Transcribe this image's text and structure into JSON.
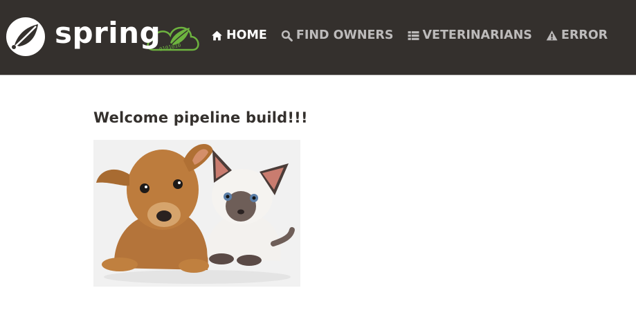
{
  "brand": {
    "wordmark": "spring",
    "cloud_digits": "0101010"
  },
  "nav": {
    "items": [
      {
        "label": "HOME",
        "icon": "home-icon",
        "active": true
      },
      {
        "label": "FIND OWNERS",
        "icon": "search-icon",
        "active": false
      },
      {
        "label": "VETERINARIANS",
        "icon": "list-icon",
        "active": false
      },
      {
        "label": "ERROR",
        "icon": "warning-icon",
        "active": false
      }
    ]
  },
  "main": {
    "heading": "Welcome pipeline build!!!",
    "image": "pets-illustration"
  },
  "colors": {
    "navbar_bg": "#34302d",
    "brand_green": "#6db33f",
    "nav_text": "#bdbbbb",
    "nav_active": "#ffffff",
    "heading": "#34302d"
  }
}
